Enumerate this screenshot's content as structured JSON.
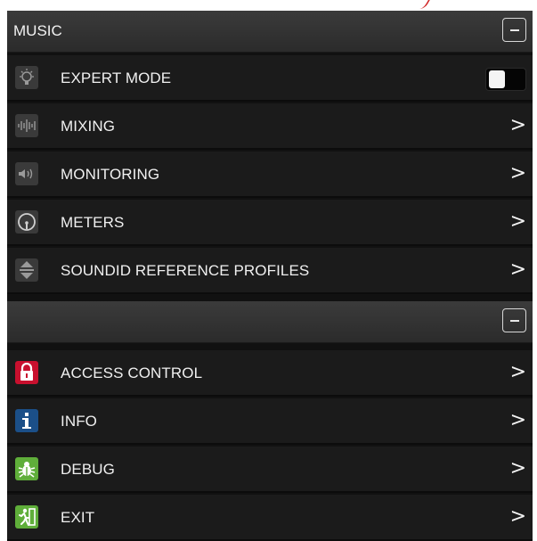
{
  "music_section": {
    "title": "MUSIC",
    "rows": [
      {
        "label": "EXPERT MODE",
        "icon": "lightbulb-icon",
        "control": "toggle",
        "toggle_on": false
      },
      {
        "label": "MIXING",
        "icon": "waveform-icon",
        "chevron": ">"
      },
      {
        "label": "MONITORING",
        "icon": "speaker-icon",
        "chevron": ">"
      },
      {
        "label": "METERS",
        "icon": "gauge-icon",
        "chevron": ">"
      },
      {
        "label": "SOUNDID REFERENCE PROFILES",
        "icon": "sort-arrows-icon",
        "chevron": ">"
      }
    ]
  },
  "system_section": {
    "title": "",
    "rows": [
      {
        "label": "ACCESS CONTROL",
        "icon": "lock-icon",
        "icon_color": "#c8102e",
        "chevron": ">"
      },
      {
        "label": "INFO",
        "icon": "info-icon",
        "icon_color": "#1b4f88",
        "chevron": ">"
      },
      {
        "label": "DEBUG",
        "icon": "bug-icon",
        "icon_color": "#5fae3a",
        "chevron": ">"
      },
      {
        "label": "EXIT",
        "icon": "exit-running-man-icon",
        "icon_color": "#5fae3a",
        "chevron": ">"
      }
    ]
  }
}
